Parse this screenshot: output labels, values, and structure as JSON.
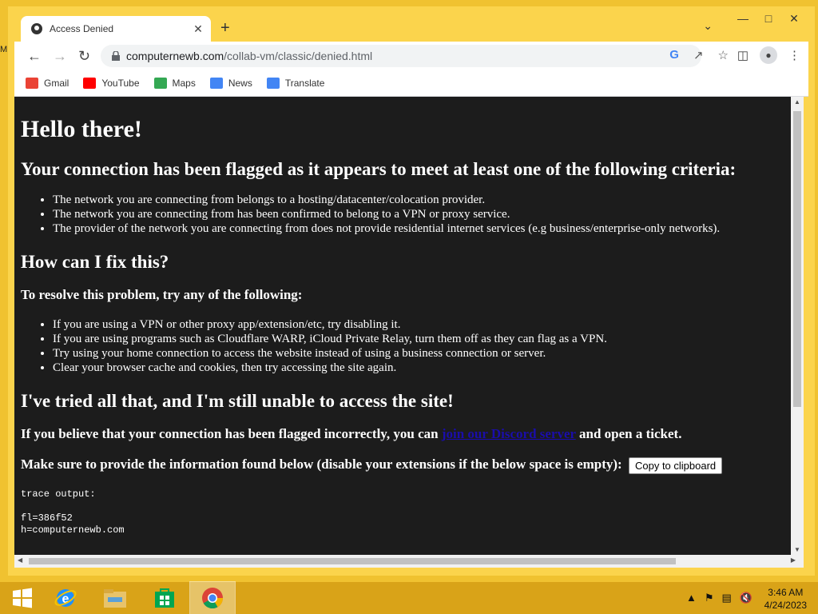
{
  "browser": {
    "tab_title": "Access Denied",
    "url_host": "computernewb.com",
    "url_path": "/collab-vm/classic/denied.html",
    "bookmarks": [
      {
        "label": "Gmail",
        "color": "#ea4335"
      },
      {
        "label": "YouTube",
        "color": "#ff0000"
      },
      {
        "label": "Maps",
        "color": "#34a853"
      },
      {
        "label": "News",
        "color": "#4285f4"
      },
      {
        "label": "Translate",
        "color": "#4285f4"
      }
    ]
  },
  "page": {
    "heading": "Hello there!",
    "flag_heading": "Your connection has been flagged as it appears to meet at least one of the following criteria:",
    "criteria": [
      "The network you are connecting from belongs to a hosting/datacenter/colocation provider.",
      "The network you are connecting from has been confirmed to belong to a VPN or proxy service.",
      "The provider of the network you are connecting from does not provide residential internet services (e.g business/enterprise-only networks)."
    ],
    "fix_heading": "How can I fix this?",
    "resolve_text": "To resolve this problem, try any of the following:",
    "fixes": [
      "If you are using a VPN or other proxy app/extension/etc, try disabling it.",
      "If you are using programs such as Cloudflare WARP, iCloud Private Relay, turn them off as they can flag as a VPN.",
      "Try using your home connection to access the website instead of using a business connection or server.",
      "Clear your browser cache and cookies, then try accessing the site again."
    ],
    "tried_heading": "I've tried all that, and I'm still unable to access the site!",
    "incorrect_pre": "If you believe that your connection has been flagged incorrectly, you can ",
    "discord_link": "join our Discord server",
    "incorrect_post": " and open a ticket.",
    "provide_text": "Make sure to provide the information found below (disable your extensions if the below space is empty):",
    "copy_button": "Copy to clipboard",
    "trace_label": "trace output:",
    "trace_lines": [
      "fl=386f52",
      "h=computernewb.com"
    ]
  },
  "taskbar": {
    "time": "3:46 AM",
    "date": "4/24/2023"
  }
}
